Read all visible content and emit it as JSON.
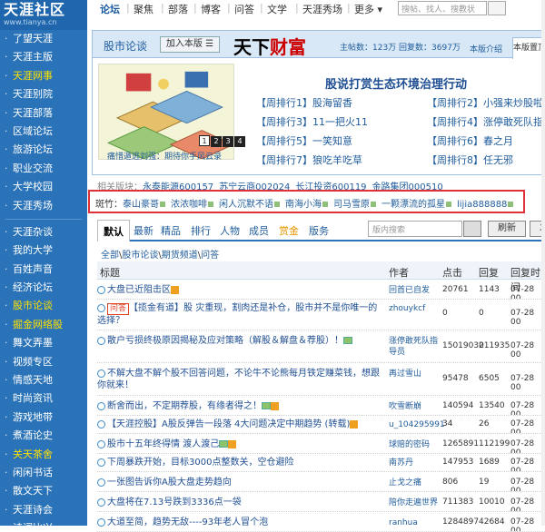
{
  "site": {
    "logo": "天涯社区",
    "url": "www.tianya.cn"
  },
  "sidebar": {
    "group1": [
      {
        "label": "了望天涯",
        "hl": false
      },
      {
        "label": "天涯主版",
        "hl": false
      },
      {
        "label": "天涯网事",
        "hl": true
      },
      {
        "label": "天涯别院",
        "hl": false
      },
      {
        "label": "天涯部落",
        "hl": false
      },
      {
        "label": "区域论坛",
        "hl": false
      },
      {
        "label": "旅游论坛",
        "hl": false
      },
      {
        "label": "职业交流",
        "hl": false
      },
      {
        "label": "大学校园",
        "hl": false
      },
      {
        "label": "天涯秀场",
        "hl": false
      }
    ],
    "group2": [
      {
        "label": "天涯杂谈",
        "hl": false
      },
      {
        "label": "我的大学",
        "hl": false
      },
      {
        "label": "百姓声音",
        "hl": false
      },
      {
        "label": "经济论坛",
        "hl": false
      },
      {
        "label": "股市论谈",
        "hl": true
      },
      {
        "label": "掘金网络股",
        "hl": true
      },
      {
        "label": "舞文弄墨",
        "hl": false
      },
      {
        "label": "视频专区",
        "hl": false
      },
      {
        "label": "情感天地",
        "hl": false
      },
      {
        "label": "时尚资讯",
        "hl": false
      },
      {
        "label": "游戏地带",
        "hl": false
      },
      {
        "label": "煮酒论史",
        "hl": false
      },
      {
        "label": "关天茶舍",
        "hl": true
      },
      {
        "label": "闲闲书话",
        "hl": false
      },
      {
        "label": "散文天下",
        "hl": false
      },
      {
        "label": "天涯诗会",
        "hl": false
      },
      {
        "label": "诗词比兴",
        "hl": false
      }
    ]
  },
  "topnav": {
    "items": [
      {
        "label": "论坛",
        "active": true
      },
      {
        "label": "聚焦"
      },
      {
        "label": "部落"
      },
      {
        "label": "博客"
      },
      {
        "label": "问答"
      },
      {
        "label": "文学"
      },
      {
        "label": "天涯秀场"
      },
      {
        "label": "更多 ▾"
      }
    ],
    "search_placeholder": "搜帖、找人、搜教状"
  },
  "board": {
    "title": "股市论谈",
    "add_label": "加入本版 ☰",
    "brand": "天下",
    "brand_red": "财富",
    "stats": "主帖数：123万  回复数：3697万",
    "intro": "本版介绍",
    "own_tab": "本版置顶",
    "illus_caption": "痛惜遁逃刘强：期待你手风云录",
    "headline": "股说打赏生态环境治理行动",
    "ranks": [
      {
        "label": "【周排行1】股海留香"
      },
      {
        "label": "【周排行2】小强来炒股啦"
      },
      {
        "label": "【周排行3】11一把火11"
      },
      {
        "label": "【周排行4】涨停敢死队指导员"
      },
      {
        "label": "【周排行5】一笑知意"
      },
      {
        "label": "【周排行6】春之月"
      },
      {
        "label": "【周排行7】狼吃羊吃草"
      },
      {
        "label": "【周排行8】任无邪"
      }
    ],
    "dots": [
      "1",
      "2",
      "3",
      "4"
    ]
  },
  "related": {
    "label": "相关版块：",
    "items": [
      "永泰能源600157",
      "苏宁云商002024",
      "长江投资600119",
      "金路集团000510"
    ]
  },
  "banzhu": {
    "label": "斑竹：",
    "items": [
      "泰山豪哥",
      "浓浓咖啡",
      "闲人沉默不语",
      "南海小海",
      "司马雪原",
      "一颗漂流的孤星",
      "lijia888888"
    ]
  },
  "tabs": {
    "items": [
      "默认",
      "最新",
      "精品",
      "排行",
      "人物",
      "成员",
      "赏金",
      "版务"
    ],
    "search_placeholder": "版内搜索",
    "refresh": "刷新",
    "post": "发帖"
  },
  "breadcrumb": {
    "a": "全部",
    "b": "股市论谈",
    "c": "期货频道",
    "d": "问答"
  },
  "table": {
    "headers": [
      "标题",
      "作者",
      "点击",
      "回复",
      "回复时间"
    ],
    "rows": [
      {
        "title": "大盘已近阻击区",
        "tag": "",
        "author": "回首已自发",
        "clicks": "20761",
        "replies": "1143",
        "time": "07-28 00"
      },
      {
        "title": "【揽金有道】股 灾重现，割肉还是补仓，股市并不是你唯一的选择？",
        "tag": "问答",
        "author": "zhouykcf",
        "clicks": "0",
        "replies": "0",
        "time": "07-28 00"
      },
      {
        "title": "散户亏损终极原因揭秘及应对策略（解股＆解盘＆荐股）！",
        "tag": "",
        "author": "涨停敢死队指导员",
        "clicks": "15019030",
        "replies": "211935",
        "time": "07-28 00"
      },
      {
        "title": "不解大盘不解个股不回答问题，不论牛不论熊每月铁定赚菜钱，想跟你就来！",
        "tag": "",
        "author": "再过雪山",
        "clicks": "95478",
        "replies": "6505",
        "time": "07-28 00"
      },
      {
        "title": "断舍而出，不定期荐股，有缘者得之！",
        "tag": "",
        "author": "吹雪断崩",
        "clicks": "140594",
        "replies": "13540",
        "time": "07-28 00"
      },
      {
        "title": "【天涯控股】A股反弹告一段落 4大问题决定中期趋势 (转载)",
        "tag": "",
        "author": "u_104295991",
        "clicks": "34",
        "replies": "26",
        "time": "07-28 00"
      },
      {
        "title": "股市十五年终得情 渡人渡己",
        "tag": "",
        "author": "球赔的密码",
        "clicks": "1265891",
        "replies": "112199",
        "time": "07-28 00"
      },
      {
        "title": "下周暴跌开始，目标3000点整数关，空仓避险",
        "tag": "",
        "author": "南苏丹",
        "clicks": "147953",
        "replies": "1689",
        "time": "07-28 00"
      },
      {
        "title": "一张图告诉你A股大盘走势趋向",
        "tag": "",
        "author": "止戈之痛",
        "clicks": "806",
        "replies": "19",
        "time": "07-28 00"
      },
      {
        "title": "大盘将在7.13号跌到3336点一袋",
        "tag": "",
        "author": "陪你走遍世界",
        "clicks": "711383",
        "replies": "10010",
        "time": "07-28 00"
      },
      {
        "title": "大道至简，趋势无敌----93年老人冒个泡",
        "tag": "",
        "author": "ranhua",
        "clicks": "1284897",
        "replies": "42684",
        "time": "07-28 00"
      }
    ]
  }
}
